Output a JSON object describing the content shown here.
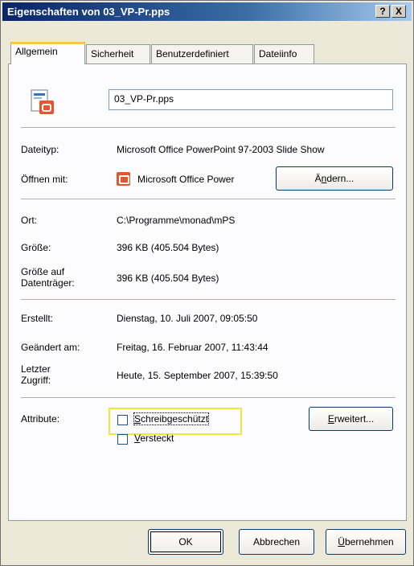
{
  "window": {
    "title": "Eigenschaften von 03_VP-Pr.pps",
    "help_btn": "?",
    "close_btn": "X"
  },
  "tabs": [
    {
      "label": "Allgemein"
    },
    {
      "label": "Sicherheit"
    },
    {
      "label": "Benutzerdefiniert"
    },
    {
      "label": "Dateiinfo"
    }
  ],
  "general": {
    "filename": "03_VP-Pr.pps",
    "filetype_label": "Dateityp:",
    "filetype_value": "Microsoft Office PowerPoint 97-2003 Slide Show",
    "openwith_label": "Öffnen mit:",
    "openwith_value": "Microsoft Office Power",
    "change_btn_pre": "Ä",
    "change_btn_accel": "n",
    "change_btn_post": "dern...",
    "location_label": "Ort:",
    "location_value": "C:\\Programme\\monad\\mPS",
    "size_label": "Größe:",
    "size_value": "396 KB (405.504 Bytes)",
    "disksize_label_1": "Größe auf",
    "disksize_label_2": "Datenträger:",
    "disksize_value": "396 KB (405.504 Bytes)",
    "created_label": "Erstellt:",
    "created_value": "Dienstag, 10. Juli 2007, 09:05:50",
    "modified_label": "Geändert am:",
    "modified_value": "Freitag, 16. Februar 2007, 11:43:44",
    "accessed_label_1": "Letzter",
    "accessed_label_2": "Zugriff:",
    "accessed_value": "Heute, 15. September 2007, 15:39:50",
    "attributes_label": "Attribute:",
    "readonly_accel": "S",
    "readonly_rest": "chreibgeschützt",
    "hidden_accel": "V",
    "hidden_rest": "ersteckt",
    "advanced_accel": "E",
    "advanced_rest": "rweitert..."
  },
  "buttons": {
    "ok": "OK",
    "cancel": "Abbrechen",
    "apply_accel": "Ü",
    "apply_rest": "bernehmen"
  },
  "colors": {
    "titlebar_start": "#0a246a",
    "highlight": "#f2e63a",
    "icon_accent": "#e4572e"
  }
}
